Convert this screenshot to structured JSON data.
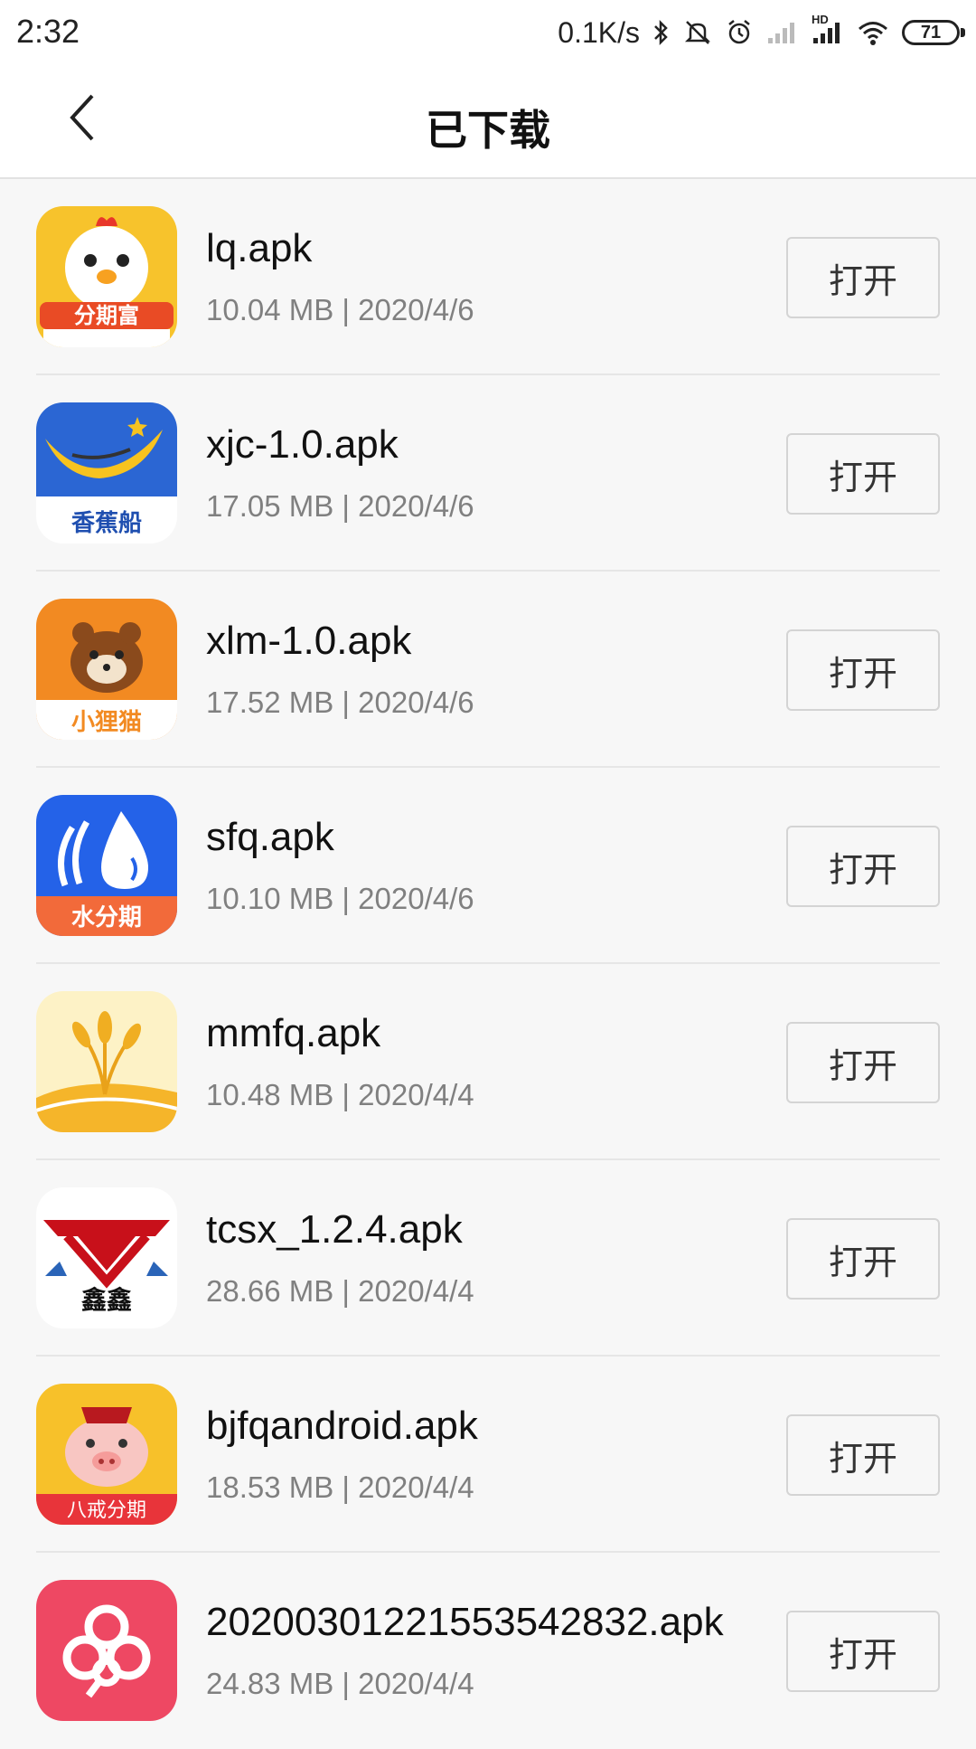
{
  "status_bar": {
    "time": "2:32",
    "net_speed": "0.1K/s",
    "hd_label": "HD",
    "battery": "71"
  },
  "header": {
    "title": "已下载"
  },
  "open_label": "打开",
  "apps": [
    {
      "name": "lq.apk",
      "meta": "10.04 MB | 2020/4/6",
      "icon": "chick-icon",
      "icon_text": "分期富",
      "color": "#f7c32c"
    },
    {
      "name": "xjc-1.0.apk",
      "meta": "17.05 MB | 2020/4/6",
      "icon": "banana-boat-icon",
      "icon_text": "香蕉船",
      "color": "#2b66d3"
    },
    {
      "name": "xlm-1.0.apk",
      "meta": "17.52 MB | 2020/4/6",
      "icon": "raccoon-icon",
      "icon_text": "小狸猫",
      "color": "#f28a22"
    },
    {
      "name": "sfq.apk",
      "meta": "10.10 MB | 2020/4/6",
      "icon": "water-drop-icon",
      "icon_text": "水分期",
      "color": "#2462e8"
    },
    {
      "name": "mmfq.apk",
      "meta": "10.48 MB | 2020/4/4",
      "icon": "wheat-icon",
      "icon_text": "",
      "color": "#f5b52a"
    },
    {
      "name": "tcsx_1.2.4.apk",
      "meta": "28.66 MB | 2020/4/4",
      "icon": "xin-logo-icon",
      "icon_text": "鑫鑫",
      "color": "#c8101a"
    },
    {
      "name": "bjfqandroid.apk",
      "meta": "18.53 MB | 2020/4/4",
      "icon": "pig-icon",
      "icon_text": "八戒分期",
      "color": "#f7a726"
    },
    {
      "name": "20200301221553542832.apk",
      "meta": "24.83 MB | 2020/4/4",
      "icon": "flower-icon",
      "icon_text": "",
      "color": "#ee4863"
    }
  ]
}
